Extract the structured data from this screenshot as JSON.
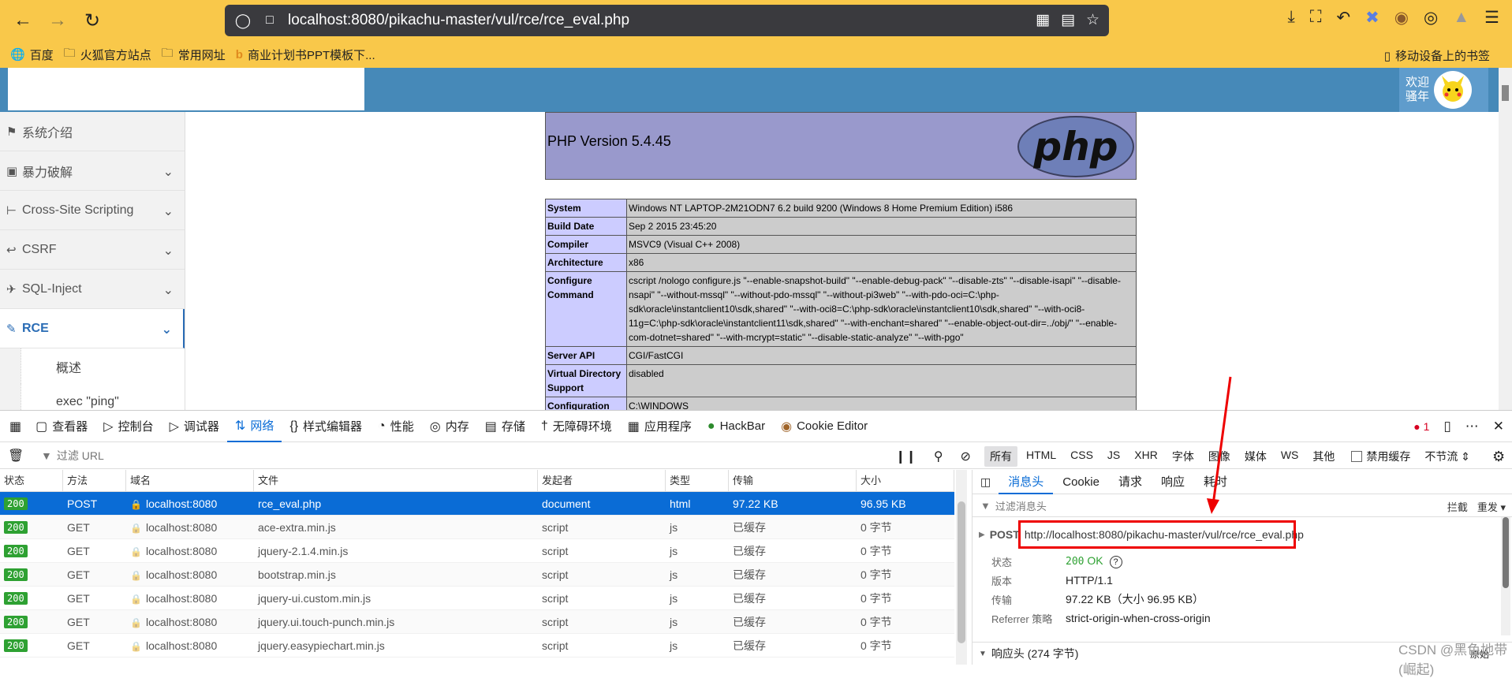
{
  "browser": {
    "url": "localhost:8080/pikachu-master/vul/rce/rce_eval.php",
    "bookmarks": [
      "百度",
      "火狐官方站点",
      "常用网址",
      "商业计划书PPT模板下..."
    ],
    "mobile_bookmarks": "移动设备上的书签"
  },
  "site": {
    "welcome": "欢迎",
    "username": "骚年",
    "sidebar": [
      {
        "label": "系统介绍",
        "icon": "tag-icon",
        "chevron": false
      },
      {
        "label": "暴力破解",
        "icon": "lock-icon",
        "chevron": true
      },
      {
        "label": "Cross-Site Scripting",
        "icon": "sitemap-icon",
        "chevron": true
      },
      {
        "label": "CSRF",
        "icon": "share-icon",
        "chevron": true
      },
      {
        "label": "SQL-Inject",
        "icon": "plane-icon",
        "chevron": true
      },
      {
        "label": "RCE",
        "icon": "pencil-icon",
        "chevron": true,
        "active": true
      }
    ],
    "subitems": [
      "概述",
      "exec \"ping\""
    ]
  },
  "phpinfo": {
    "version": "PHP Version 5.4.45",
    "logo_text": "php",
    "rows": [
      {
        "k": "System",
        "v": "Windows NT LAPTOP-2M21ODN7 6.2 build 9200 (Windows 8 Home Premium Edition) i586"
      },
      {
        "k": "Build Date",
        "v": "Sep 2 2015 23:45:20"
      },
      {
        "k": "Compiler",
        "v": "MSVC9 (Visual C++ 2008)"
      },
      {
        "k": "Architecture",
        "v": "x86"
      },
      {
        "k": "Configure Command",
        "v": "cscript /nologo configure.js \"--enable-snapshot-build\" \"--enable-debug-pack\" \"--disable-zts\" \"--disable-isapi\" \"--disable-nsapi\" \"--without-mssql\" \"--without-pdo-mssql\" \"--without-pi3web\" \"--with-pdo-oci=C:\\php-sdk\\oracle\\instantclient10\\sdk,shared\" \"--with-oci8=C:\\php-sdk\\oracle\\instantclient10\\sdk,shared\" \"--with-oci8-11g=C:\\php-sdk\\oracle\\instantclient11\\sdk,shared\" \"--with-enchant=shared\" \"--enable-object-out-dir=../obj/\" \"--enable-com-dotnet=shared\" \"--with-mcrypt=static\" \"--disable-static-analyze\" \"--with-pgo\""
      },
      {
        "k": "Server API",
        "v": "CGI/FastCGI"
      },
      {
        "k": "Virtual Directory Support",
        "v": "disabled"
      },
      {
        "k": "Configuration File (php.ini) Path",
        "v": "C:\\WINDOWS"
      }
    ]
  },
  "devtools": {
    "tabs": [
      {
        "label": "查看器",
        "icon": "inspector-icon"
      },
      {
        "label": "控制台",
        "icon": "console-icon"
      },
      {
        "label": "调试器",
        "icon": "debugger-icon"
      },
      {
        "label": "网络",
        "icon": "network-icon",
        "active": true
      },
      {
        "label": "样式编辑器",
        "icon": "style-editor-icon"
      },
      {
        "label": "性能",
        "icon": "performance-icon"
      },
      {
        "label": "内存",
        "icon": "memory-icon"
      },
      {
        "label": "存储",
        "icon": "storage-icon"
      },
      {
        "label": "无障碍环境",
        "icon": "accessibility-icon"
      },
      {
        "label": "应用程序",
        "icon": "application-icon"
      },
      {
        "label": "HackBar",
        "icon": "hackbar-icon"
      },
      {
        "label": "Cookie Editor",
        "icon": "cookie-icon"
      }
    ],
    "error_count": "1",
    "filter_placeholder": "过滤 URL",
    "type_filters": [
      "所有",
      "HTML",
      "CSS",
      "JS",
      "XHR",
      "字体",
      "图像",
      "媒体",
      "WS",
      "其他"
    ],
    "disable_cache": "禁用缓存",
    "throttle": "不节流 ⇕",
    "columns": [
      "状态",
      "方法",
      "域名",
      "文件",
      "发起者",
      "类型",
      "传输",
      "大小"
    ],
    "requests": [
      {
        "status": "200",
        "method": "POST",
        "domain": "localhost:8080",
        "file": "rce_eval.php",
        "initiator": "document",
        "type": "html",
        "transferred": "97.22 KB",
        "size": "96.95 KB",
        "selected": true
      },
      {
        "status": "200",
        "method": "GET",
        "domain": "localhost:8080",
        "file": "ace-extra.min.js",
        "initiator": "script",
        "type": "js",
        "transferred": "已缓存",
        "size": "0 字节"
      },
      {
        "status": "200",
        "method": "GET",
        "domain": "localhost:8080",
        "file": "jquery-2.1.4.min.js",
        "initiator": "script",
        "type": "js",
        "transferred": "已缓存",
        "size": "0 字节"
      },
      {
        "status": "200",
        "method": "GET",
        "domain": "localhost:8080",
        "file": "bootstrap.min.js",
        "initiator": "script",
        "type": "js",
        "transferred": "已缓存",
        "size": "0 字节"
      },
      {
        "status": "200",
        "method": "GET",
        "domain": "localhost:8080",
        "file": "jquery-ui.custom.min.js",
        "initiator": "script",
        "type": "js",
        "transferred": "已缓存",
        "size": "0 字节"
      },
      {
        "status": "200",
        "method": "GET",
        "domain": "localhost:8080",
        "file": "jquery.ui.touch-punch.min.js",
        "initiator": "script",
        "type": "js",
        "transferred": "已缓存",
        "size": "0 字节"
      },
      {
        "status": "200",
        "method": "GET",
        "domain": "localhost:8080",
        "file": "jquery.easypiechart.min.js",
        "initiator": "script",
        "type": "js",
        "transferred": "已缓存",
        "size": "0 字节"
      }
    ],
    "detail_tabs": [
      "消息头",
      "Cookie",
      "请求",
      "响应",
      "耗时"
    ],
    "detail_filter_placeholder": "过滤消息头",
    "block": "拦截",
    "resend": "重发 ▾",
    "request_method": "POST",
    "request_url": "http://localhost:8080/pikachu-master/vul/rce/rce_eval.php",
    "status_label": "状态",
    "status_code": "200",
    "status_text": "OK",
    "version_label": "版本",
    "version": "HTTP/1.1",
    "transfer_label": "传输",
    "transfer": "97.22 KB（大小 96.95 KB）",
    "referrer_label": "Referrer 策略",
    "referrer": "strict-origin-when-cross-origin",
    "response_headers": "响应头 (274 字节)",
    "raw_label": "原始"
  },
  "watermark": "CSDN @黑色地带(崛起)",
  "colors": {
    "toolbar": "#f9c84a",
    "header": "#4689b8",
    "accent": "#0a6cd6",
    "highlight": "#e00000"
  }
}
